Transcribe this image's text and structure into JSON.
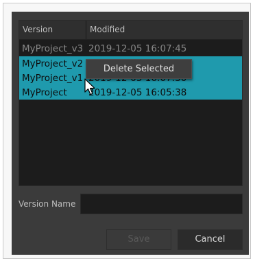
{
  "columns": {
    "version": "Version",
    "modified": "Modified"
  },
  "rows": [
    {
      "version": "MyProject_v3",
      "modified": "2019-12-05 16:07:45",
      "selected": false
    },
    {
      "version": "MyProject_v2",
      "modified": "",
      "selected": true
    },
    {
      "version": "MyProject_v1",
      "modified": "2019-12-05 16:07:30",
      "selected": true
    },
    {
      "version": "MyProject",
      "modified": "2019-12-05 16:05:38",
      "selected": true
    }
  ],
  "context_menu": {
    "delete_label": "Delete Selected"
  },
  "version_name": {
    "label": "Version Name",
    "value": ""
  },
  "buttons": {
    "save": "Save",
    "cancel": "Cancel"
  },
  "colors": {
    "selection": "#1f9aad",
    "dialog_bg": "#3b3b3b",
    "list_bg": "#1c1c1c"
  }
}
